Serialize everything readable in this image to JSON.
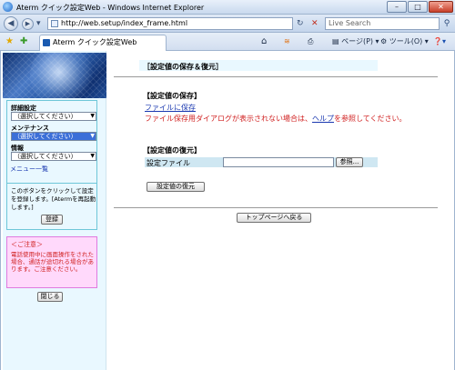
{
  "window": {
    "title": "Aterm クイック設定Web - Windows Internet Explorer",
    "controls": {
      "minimize": "–",
      "maximize": "□",
      "close": "✕"
    }
  },
  "address_bar": {
    "url": "http://web.setup/index_frame.html",
    "search_placeholder": "Live Search"
  },
  "tab_bar": {
    "tab_title": "Aterm クイック設定Web",
    "page_menu": "ページ(P)",
    "tools_menu": "ツール(O)"
  },
  "sidebar": {
    "advanced_label": "詳細設定",
    "advanced_select": "（選択してください）",
    "maintenance_label": "メンテナンス",
    "maintenance_select": "（選択してください）",
    "info_label": "情報",
    "info_select": "（選択してください）",
    "menu_list_link": "メニュー一覧",
    "register_text": "このボタンをクリックして設定を登録します。[Atermを再起動します。]",
    "register_button": "登録",
    "note_heading": "＜ご注意＞",
    "note_text": "電話使用中に画面操作をされた場合、通話が途切れる場合があります。ご注意ください。",
    "close_button": "閉じる"
  },
  "main": {
    "page_title": "［設定値の保存＆復元］",
    "save_heading": "【設定値の保存】",
    "save_link": "ファイルに保存",
    "save_warning_prefix": "ファイル保存用ダイアログが表示されない場合は、",
    "save_warning_link": "ヘルプ",
    "save_warning_suffix": "を参照してください。",
    "restore_heading": "【設定値の復元】",
    "file_label": "設定ファイル",
    "browse_button": "参照...",
    "restore_button": "設定値の復元",
    "top_page_button": "トップページへ戻る"
  },
  "icons": [
    "ie-logo-icon",
    "back-icon",
    "forward-icon",
    "page-icon",
    "refresh-icon",
    "stop-icon",
    "search-icon",
    "favorites-star-icon",
    "add-favorites-icon",
    "home-icon",
    "feeds-icon",
    "print-icon",
    "help-icon"
  ]
}
